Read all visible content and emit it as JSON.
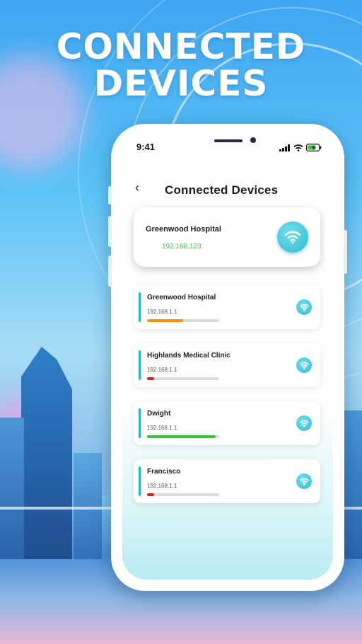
{
  "headline": {
    "line1": "CONNECTED",
    "line2": "DEVICES"
  },
  "status_bar": {
    "time": "9:41"
  },
  "header": {
    "back_icon": "chevron-left-icon",
    "back_glyph": "‹",
    "title": "Connected Devices"
  },
  "current_network": {
    "name": "Greenwood Hospital",
    "ip": "192.168.123",
    "icon": "wifi-icon"
  },
  "devices": [
    {
      "name": "Greenwood Hospital",
      "ip": "192.168.1.1",
      "signal": 0.5,
      "color": "#f7941d",
      "icon": "wifi-icon"
    },
    {
      "name": "Highlands Medical Clinic",
      "ip": "192.168.1.1",
      "signal": 0.1,
      "color": "#e01e1e",
      "icon": "wifi-icon"
    },
    {
      "name": "Dwight",
      "ip": "192.168.1.1",
      "signal": 0.95,
      "color": "#3cc23c",
      "icon": "wifi-icon"
    },
    {
      "name": "Francisco",
      "ip": "192.168.1.1",
      "signal": 0.1,
      "color": "#e01e1e",
      "icon": "wifi-icon"
    }
  ],
  "colors": {
    "accent": "#2ab3cf",
    "ip_green": "#44c243"
  }
}
